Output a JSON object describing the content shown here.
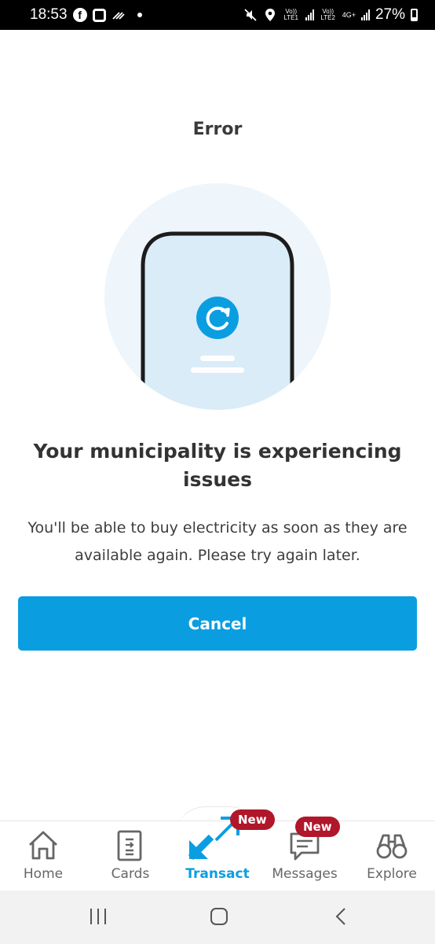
{
  "status_bar": {
    "time": "18:53",
    "sim1_label": "Vo)) LTE1",
    "sim2_label": "Vo)) LTE2",
    "network_type": "4G+",
    "battery_percent": "27%"
  },
  "header": {
    "title": "Error"
  },
  "illustration": {
    "icon": "refresh-icon"
  },
  "message": {
    "heading": "Your municipality is experiencing issues",
    "body": "You'll be able to buy electricity as soon as they are available again. Please try again later."
  },
  "actions": {
    "cancel_label": "Cancel"
  },
  "bottom_nav": {
    "items": [
      {
        "label": "Home",
        "icon": "home-icon"
      },
      {
        "label": "Cards",
        "icon": "cards-icon"
      },
      {
        "label": "Transact",
        "icon": "transact-icon",
        "badge": "New",
        "active": true
      },
      {
        "label": "Messages",
        "icon": "messages-icon",
        "badge": "New"
      },
      {
        "label": "Explore",
        "icon": "binoculars-icon"
      }
    ]
  },
  "colors": {
    "accent": "#0a9ee1",
    "badge": "#b0172b",
    "illustration_bg": "#eef5fb",
    "phone_screen": "#d9ecf8"
  }
}
